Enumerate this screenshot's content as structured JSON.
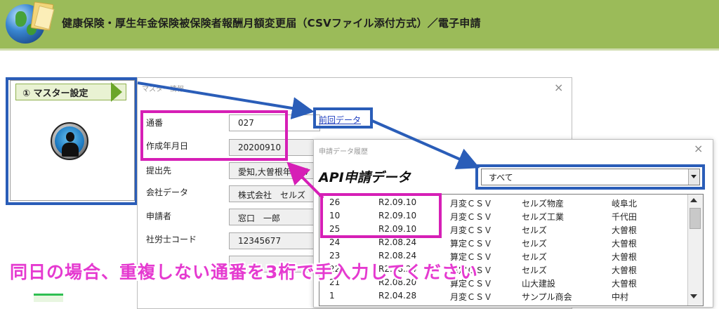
{
  "header": {
    "title": "健康保険・厚生年金保険被保険者報酬月額変更届（CSVファイル添付方式）／電子申請"
  },
  "master_panel": {
    "tab_label": "①  マスター設定"
  },
  "master_dialog": {
    "title": "マスター情報",
    "close": "×",
    "fields": [
      {
        "label": "通番",
        "value": "027"
      },
      {
        "label": "作成年月日",
        "value": "20200910"
      },
      {
        "label": "提出先",
        "value": "愛知,大曽根年金事"
      },
      {
        "label": "会社データ",
        "value": "株式会社　セルズ"
      },
      {
        "label": "申請者",
        "value": "窓口　一郎"
      },
      {
        "label": "社労士コード",
        "value": "12345677"
      },
      {
        "label": "",
        "value": ""
      }
    ],
    "prev_link": "前回データ"
  },
  "history_dialog": {
    "title": "申請データ履歴",
    "close": "×",
    "heading": "API申請データ",
    "filter_value": "すべて",
    "rows": [
      [
        "26",
        "R2.09.10",
        "月変ＣＳＶ",
        "セルズ物産",
        "岐阜北"
      ],
      [
        "10",
        "R2.09.10",
        "月変ＣＳＶ",
        "セルズ工業",
        "千代田"
      ],
      [
        "25",
        "R2.09.10",
        "月変ＣＳＶ",
        "セルズ",
        "大曽根"
      ],
      [
        "24",
        "R2.08.24",
        "算定ＣＳＶ",
        "セルズ",
        "大曽根"
      ],
      [
        "23",
        "R2.08.24",
        "算定ＣＳＶ",
        "セルズ",
        "大曽根"
      ],
      [
        "22",
        "R2.08.24",
        "算定ＣＳＶ",
        "セルズ",
        "大曽根"
      ],
      [
        "21",
        "R2.08.20",
        "算定ＣＳＶ",
        "山大建設",
        "大曽根"
      ],
      [
        "1",
        "R2.04.28",
        "月変ＣＳＶ",
        "サンプル商会",
        "中村"
      ]
    ]
  },
  "annotation": {
    "note": "同日の場合、重複しない通番を3桁で手入力してください"
  },
  "colors": {
    "header_bg": "#9bbb59",
    "highlight_blue": "#2a5db8",
    "highlight_magenta": "#d61fb6",
    "note_text": "#e53ad0"
  }
}
